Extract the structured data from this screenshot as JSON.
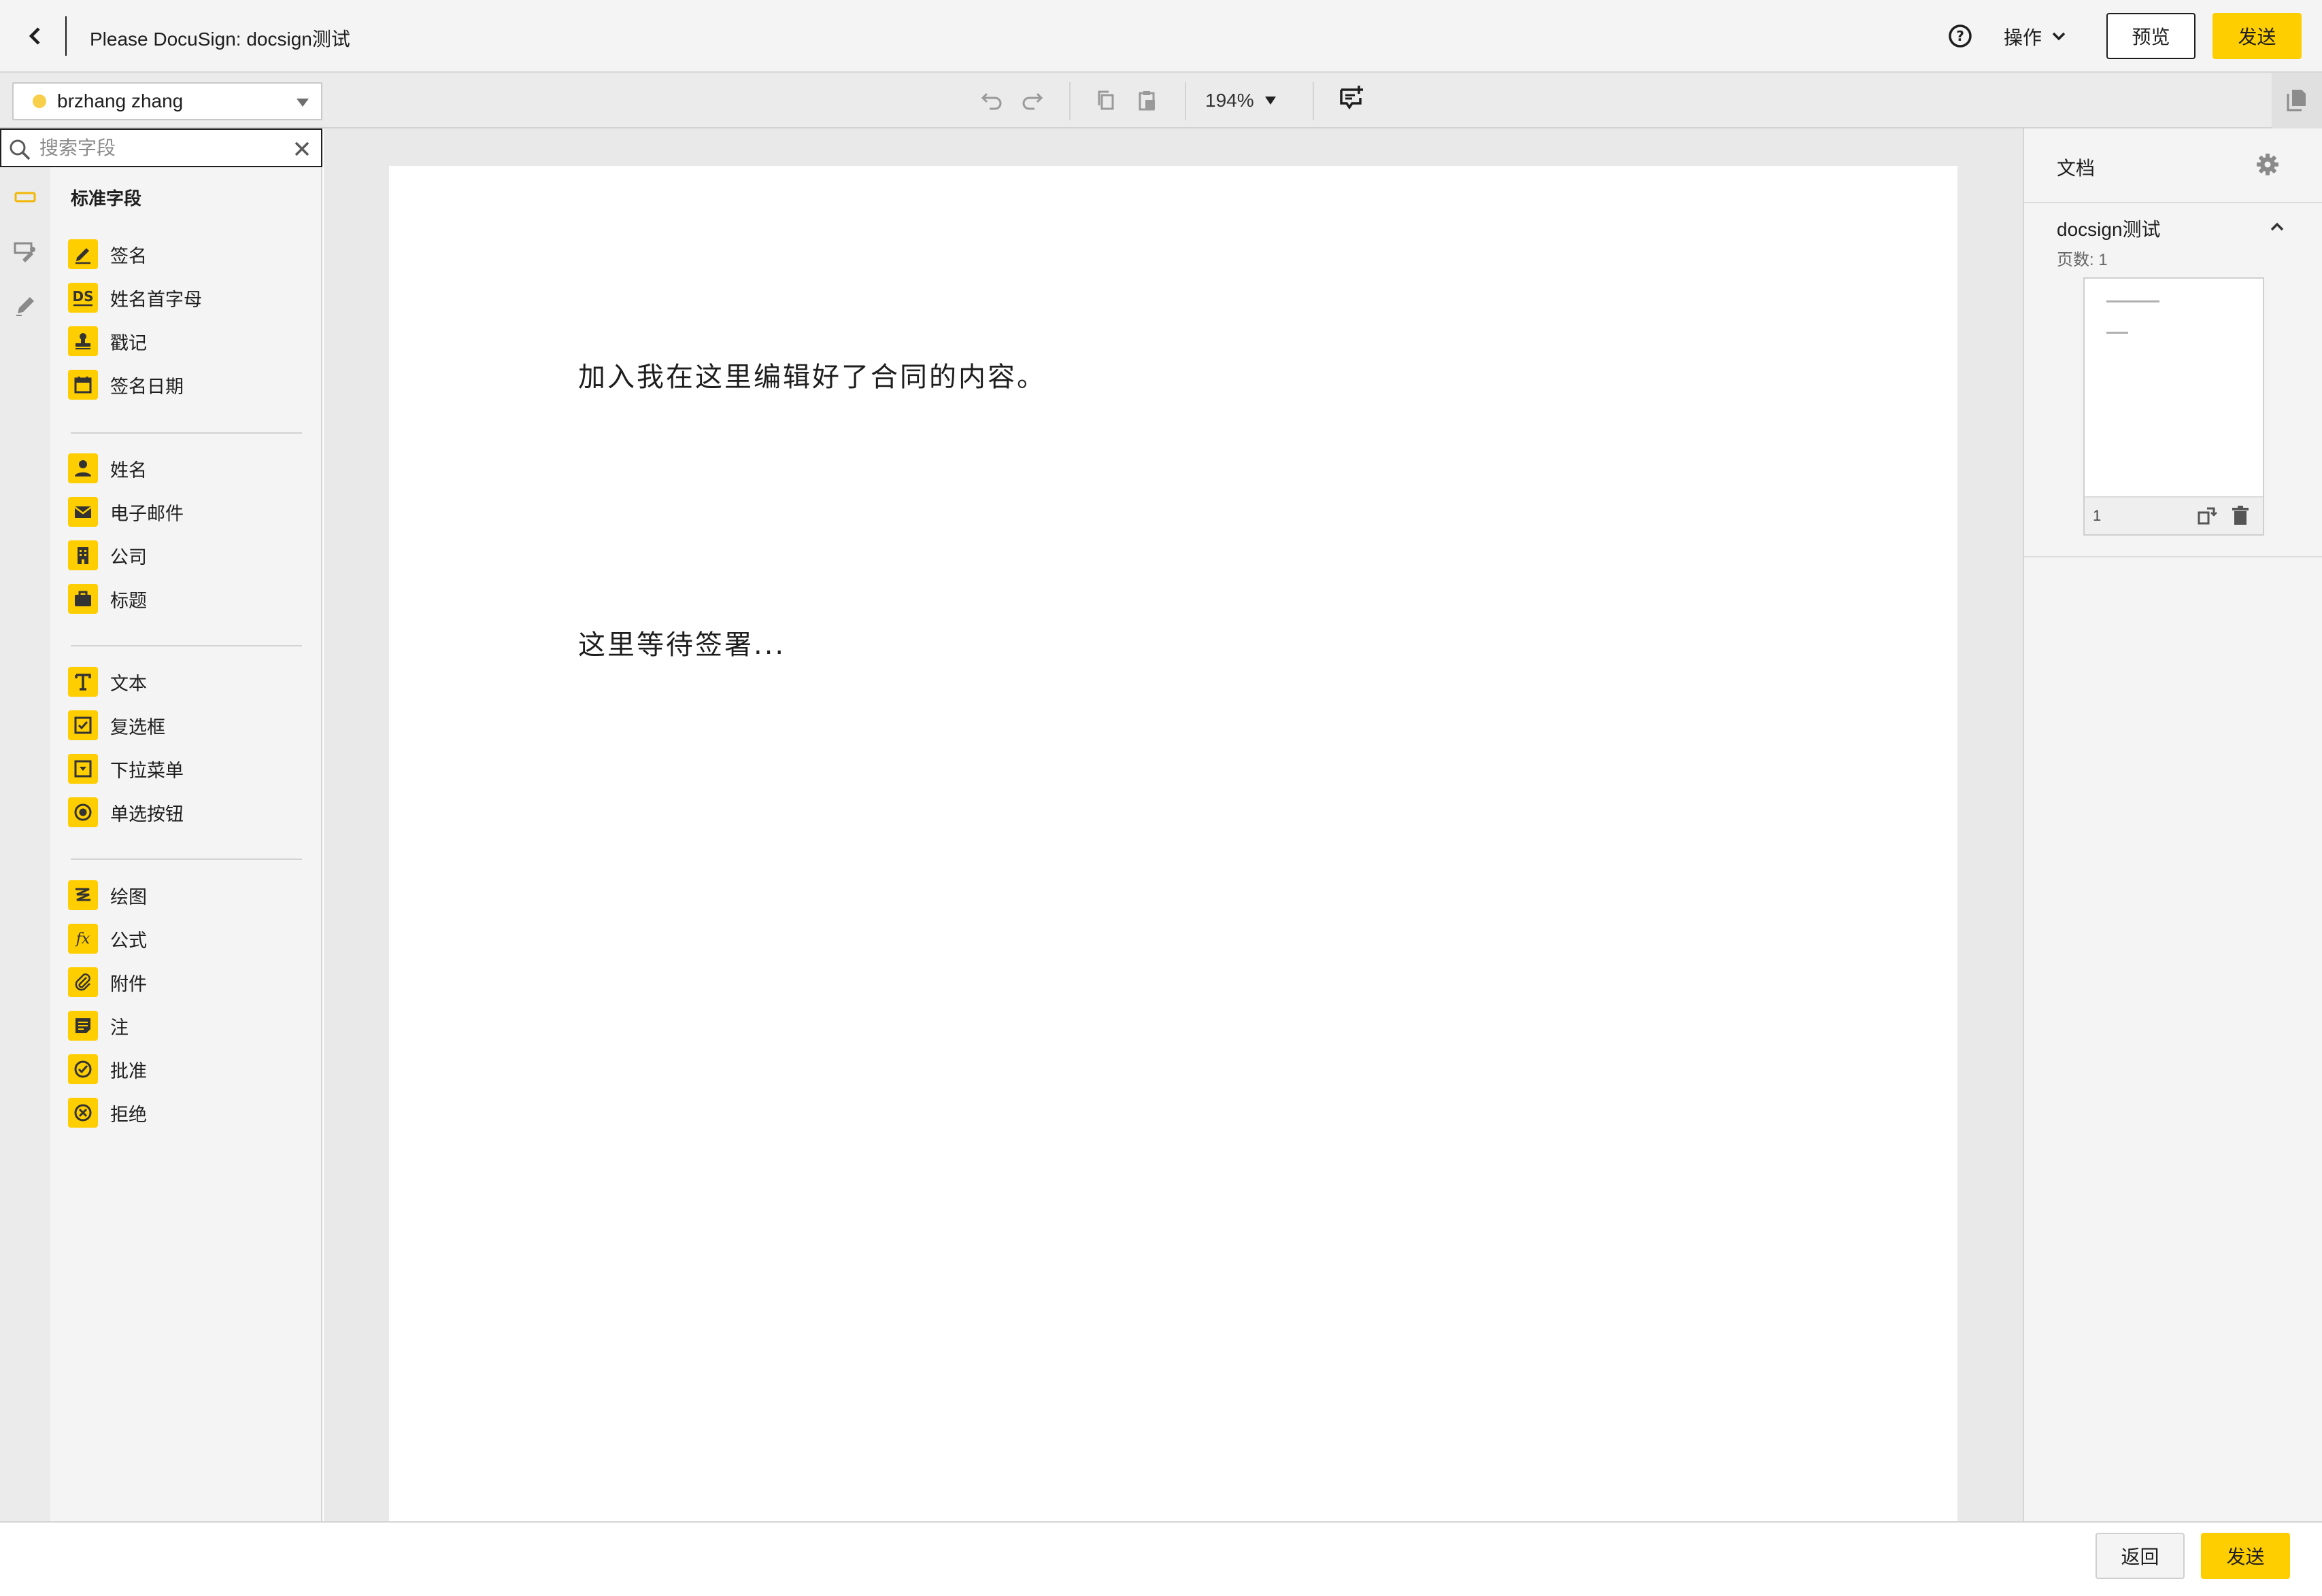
{
  "header": {
    "title": "Please DocuSign: docsign测试",
    "ops_label": "操作",
    "preview_label": "预览",
    "send_label": "发送"
  },
  "toolbar": {
    "recipient": "brzhang zhang",
    "zoom": "194%"
  },
  "search": {
    "placeholder": "搜索字段",
    "value": ""
  },
  "fields": {
    "heading": "标准字段",
    "groups": [
      [
        {
          "label": "签名",
          "icon": "signature-icon"
        },
        {
          "label": "姓名首字母",
          "icon": "initials-icon"
        },
        {
          "label": "戳记",
          "icon": "stamp-icon"
        },
        {
          "label": "签名日期",
          "icon": "calendar-icon"
        }
      ],
      [
        {
          "label": "姓名",
          "icon": "person-icon"
        },
        {
          "label": "电子邮件",
          "icon": "envelope-icon"
        },
        {
          "label": "公司",
          "icon": "building-icon"
        },
        {
          "label": "标题",
          "icon": "briefcase-icon"
        }
      ],
      [
        {
          "label": "文本",
          "icon": "text-icon"
        },
        {
          "label": "复选框",
          "icon": "checkbox-icon"
        },
        {
          "label": "下拉菜单",
          "icon": "dropdown-icon"
        },
        {
          "label": "单选按钮",
          "icon": "radio-icon"
        }
      ],
      [
        {
          "label": "绘图",
          "icon": "drawing-icon"
        },
        {
          "label": "公式",
          "icon": "formula-icon"
        },
        {
          "label": "附件",
          "icon": "paperclip-icon"
        },
        {
          "label": "注",
          "icon": "note-icon"
        },
        {
          "label": "批准",
          "icon": "approve-icon"
        },
        {
          "label": "拒绝",
          "icon": "decline-icon"
        }
      ]
    ]
  },
  "document": {
    "line1": "加入我在这里编辑好了合同的内容。",
    "line2": "这里等待签署..."
  },
  "right_panel": {
    "heading": "文档",
    "doc_name": "docsign测试",
    "page_count": "页数: 1",
    "thumb_page_number": "1"
  },
  "footer": {
    "back_label": "返回",
    "send_label": "发送"
  },
  "colors": {
    "accent": "#ffce00",
    "recipient_dot": "#f7cf4a"
  }
}
